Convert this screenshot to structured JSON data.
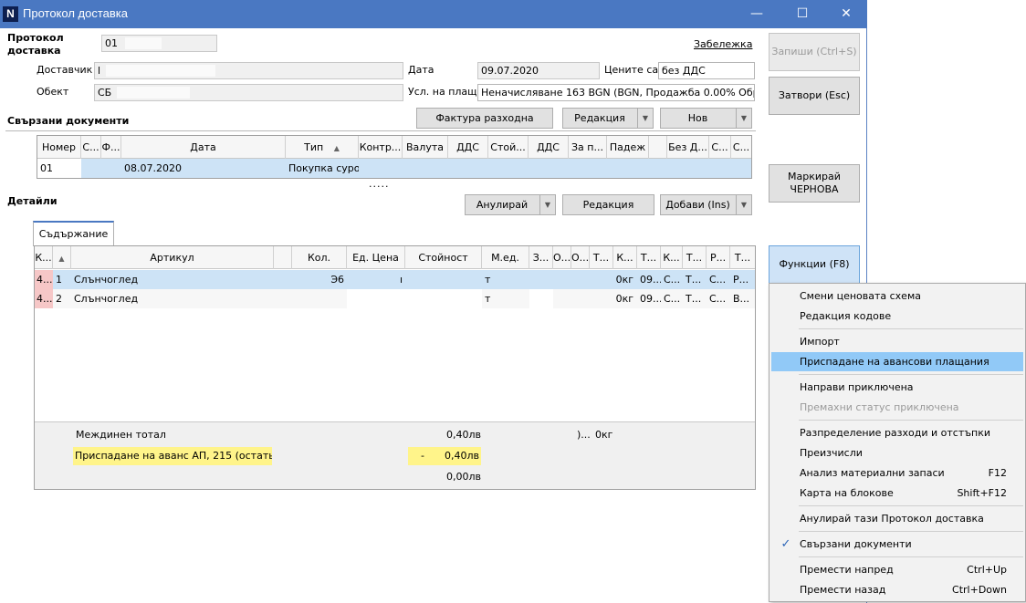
{
  "window": {
    "app_icon": "N",
    "title": "Протокол доставка",
    "minimize": "—",
    "maximize": "☐",
    "close": "✕"
  },
  "header": {
    "protocol_label": "Протокол доставка",
    "protocol_number": "01",
    "note_link": "Забележка",
    "supplier_label": "Доставчик",
    "supplier_value": "l",
    "object_label": "Обект",
    "object_value": "СБ",
    "date_label": "Дата",
    "date_value": "09.07.2020",
    "prices_label": "Цените са",
    "prices_value": "без ДДС",
    "payment_label": "Усл. на плащ.",
    "payment_value": "Неначисляване 163 BGN (BGN, Продажба 0.00% Обратно"
  },
  "right_buttons": {
    "save": "Запиши (Ctrl+S)",
    "close": "Затвори (Esc)",
    "mark_draft": "Маркирай ЧЕРНОВА",
    "functions": "Функции (F8)"
  },
  "related": {
    "title": "Свързани документи",
    "invoice_button": "Фактура разходна",
    "edit_button": "Редакция",
    "new_button": "Нов",
    "columns": [
      "Номер",
      "С...",
      "Ф...",
      "Дата",
      "Тип",
      "Контр...",
      "Валута",
      "ДДС",
      "Стой...",
      "ДДС",
      "За п...",
      "Падеж",
      "Без Д...",
      "С...",
      "С..."
    ],
    "rows": [
      {
        "number": "01",
        "date": "08.07.2020",
        "type": "Покупка суро"
      }
    ],
    "splitter": "....."
  },
  "details": {
    "title": "Детайли",
    "cancel_button": "Анулирай",
    "edit_button": "Редакция",
    "add_button": "Добави (Ins)",
    "tab": "Съдържание",
    "columns": [
      "К...",
      "",
      "Артикул",
      "",
      "Кол.",
      "Ед. Цена",
      "Стойност",
      "М.ед.",
      "З...",
      "О...",
      "О...",
      "Т...",
      "К...",
      "Т...",
      "К...",
      "Т...",
      "Р...",
      "Т..."
    ],
    "rows": [
      {
        "k": "4...",
        "n": "1",
        "article": "Слънчоглед",
        "qty": "Э6",
        "price": "ı",
        "unit": "т",
        "t1": "0кг",
        "t2": "09...",
        "k2": "С...",
        "t3": "Т...",
        "r": "С...",
        "t4": "Р..."
      },
      {
        "k": "4...",
        "n": "2",
        "article": "Слънчоглед",
        "qty": "",
        "price": "",
        "unit": "т",
        "t1": "0кг",
        "t2": "09...",
        "k2": "С...",
        "t3": "Т...",
        "r": "С...",
        "t4": "В..."
      }
    ],
    "subtotal_label": "Междинен тотал",
    "subtotal_value": "0,40лв",
    "subtotal_extra": ")...",
    "subtotal_kg": "0кг",
    "advance_label": "Приспадане на аванс АП, 215 (остать...",
    "advance_sign": "-",
    "advance_value": "0,40лв",
    "total_value": "0,00лв"
  },
  "menu": {
    "items": [
      {
        "label": "Смени ценовата схема",
        "shortcut": ""
      },
      {
        "label": "Редакция кодове",
        "shortcut": ""
      },
      {
        "label": "Импорт",
        "shortcut": ""
      },
      {
        "label": "Приспадане на авансови плащания",
        "shortcut": ""
      },
      {
        "label": "Направи приключена",
        "shortcut": ""
      },
      {
        "label": "Премахни статус приключена",
        "shortcut": ""
      },
      {
        "label": "Разпределение разходи и отстъпки",
        "shortcut": ""
      },
      {
        "label": "Преизчисли",
        "shortcut": ""
      },
      {
        "label": "Анализ материални запаси",
        "shortcut": "F12"
      },
      {
        "label": "Карта на блокове",
        "shortcut": "Shift+F12"
      },
      {
        "label": "Анулирай тази Протокол доставка",
        "shortcut": ""
      },
      {
        "label": "Свързани документи",
        "shortcut": ""
      },
      {
        "label": "Премести напред",
        "shortcut": "Ctrl+Up"
      },
      {
        "label": "Премести назад",
        "shortcut": "Ctrl+Down"
      }
    ],
    "check_mark": "✓"
  },
  "colors": {
    "titlebar": "#4a78c2",
    "selected_row": "#cde3f6",
    "menu_highlight": "#91c9f7",
    "advance_highlight": "#fff48a",
    "flag_pink": "#f6c7c7"
  }
}
